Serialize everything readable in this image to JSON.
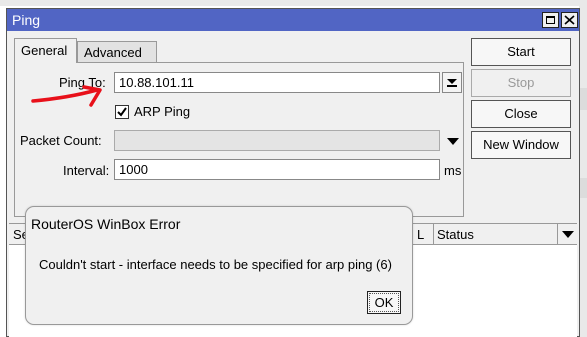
{
  "window": {
    "title": "Ping",
    "maximize_icon": "maximize-icon",
    "close_icon": "close-icon"
  },
  "tabs": [
    {
      "label": "General",
      "active": true
    },
    {
      "label": "Advanced",
      "active": false
    }
  ],
  "form": {
    "ping_to_label": "Ping To:",
    "ping_to_value": "10.88.101.11",
    "arp_ping_label": "ARP Ping",
    "arp_ping_checked": true,
    "packet_count_label": "Packet Count:",
    "packet_count_value": "",
    "interval_label": "Interval:",
    "interval_value": "1000",
    "interval_unit": "ms"
  },
  "buttons": {
    "start": "Start",
    "stop": "Stop",
    "close": "Close",
    "new_window": "New Window"
  },
  "list": {
    "columns": [
      "Se",
      "Status"
    ]
  },
  "error_dialog": {
    "title": "RouterOS WinBox Error",
    "message": "Couldn't start - interface needs to be specified for arp ping (6)",
    "ok_label": "OK"
  },
  "colors": {
    "titlebar": "#5165c4",
    "annotation_red": "#e8101a"
  }
}
